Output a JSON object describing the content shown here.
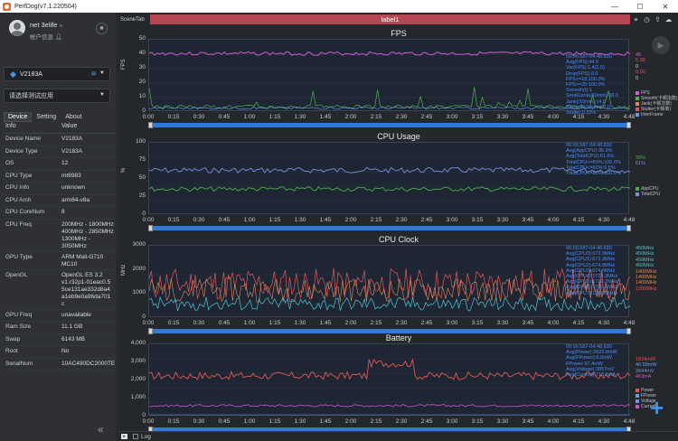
{
  "window": {
    "title": "PerfDog(v7.1.220504)",
    "buttons": [
      "—",
      "☐",
      "✕"
    ]
  },
  "user": {
    "name": "net 3elife",
    "info_label": "帐户信息"
  },
  "device": {
    "selected": "V2183A"
  },
  "app_select": {
    "placeholder": "请选择测试应用"
  },
  "tabs": [
    "Device",
    "Setting",
    "About"
  ],
  "info": {
    "headers": [
      "Info",
      "Value"
    ],
    "rows": [
      {
        "k": "Device Name",
        "v": "V2183A"
      },
      {
        "k": "Device Type",
        "v": "V2183A"
      },
      {
        "k": "OS",
        "v": "12"
      },
      {
        "k": "CPU Type",
        "v": "mt6983"
      },
      {
        "k": "CPU Info",
        "v": "unknown"
      },
      {
        "k": "CPU Arch",
        "v": "arm64-v8a"
      },
      {
        "k": "CPU CoreNum",
        "v": "8"
      },
      {
        "k": "CPU Freq",
        "v": "200MHz - 1800MHz\n400MHz - 2850MHz\n1300MHz -\n3050MHz"
      },
      {
        "k": "GPU Type",
        "v": "ARM Mali-G710\nMC10"
      },
      {
        "k": "OpenGL",
        "v": "OpenGL ES 3.2\nv1.r32p1-01eac0.5\n5ce131ae332d8a4\na1eb9e0a96da701\nc"
      },
      {
        "k": "GPU Freq",
        "v": "unavailable"
      },
      {
        "k": "Ram Size",
        "v": "11.1 GB"
      },
      {
        "k": "Swap",
        "v": "6143 MB"
      },
      {
        "k": "Root",
        "v": "No"
      },
      {
        "k": "SerialNum",
        "v": "10AC490DC2000TE"
      }
    ]
  },
  "scene": {
    "tab": "SceneTab",
    "label": "label1"
  },
  "x_ticks": [
    "0:00",
    "0:15",
    "0:30",
    "0:45",
    "1:00",
    "1:15",
    "1:30",
    "1:45",
    "2:00",
    "2:15",
    "2:30",
    "2:45",
    "3:00",
    "3:15",
    "3:30",
    "3:45",
    "4:00",
    "4:15",
    "4:30",
    "4:48"
  ],
  "panels": [
    {
      "title": "FPS",
      "ylabel": "FPS",
      "yticks": [
        "50",
        "40",
        "30",
        "20",
        "10",
        "0"
      ],
      "legend_box": [
        "00:00.587-04:48.630",
        "Avg(FPS):44.5",
        "Var(FPS):1.4(1.5)",
        "Drop(FPS):0.0",
        "FPS>=18:100.0%",
        "FPS>=25:100.0%",
        "Smooth(t):1",
        "SmallJank(/10min):68.0",
        "Jank(/10min):14.0",
        "BigJank(/10min):0.0",
        "Stutter:0.32%"
      ],
      "right_values": [
        {
          "t": "45",
          "c": "#d25ad3"
        },
        {
          "t": "5.38",
          "c": "#e05858"
        },
        {
          "t": "0",
          "c": "#cfd3d8"
        },
        {
          "t": "0.00",
          "c": "#e05858"
        },
        {
          "t": "0",
          "c": "#cfd3d8"
        }
      ],
      "right_legend": [
        {
          "t": "FPS",
          "c": "#d25ad3"
        },
        {
          "t": "Smooth(卡顿指数)",
          "c": "#4caf50"
        },
        {
          "t": "Jank(卡顿次数)",
          "c": "#e08a5a"
        },
        {
          "t": "Stutter(卡顿率)",
          "c": "#e05858"
        },
        {
          "t": "InterFrame",
          "c": "#5fa0e8"
        }
      ]
    },
    {
      "title": "CPU Usage",
      "ylabel": "%",
      "yticks": [
        "100",
        "75",
        "50",
        "25",
        "0"
      ],
      "legend_box": [
        "00:00.587-04:48.630",
        "Avg(AppCPU):35.9%",
        "Avg(TotalCPU):61.6%",
        "TotalCPU<=50%:100.0%",
        "TotalCPU<=60%:6.5%",
        "TotalCPU<=80%:100.0%"
      ],
      "right_values": [
        {
          "t": "39%",
          "c": "#4caf50"
        },
        {
          "t": "61%",
          "c": "#7a8fe0"
        }
      ],
      "right_legend": [
        {
          "t": "AppCPU",
          "c": "#4caf50"
        },
        {
          "t": "TotalCPU",
          "c": "#7a8fe0"
        }
      ]
    },
    {
      "title": "CPU Clock",
      "ylabel": "MHz",
      "yticks": [
        "3000",
        "2000",
        "1000",
        "0"
      ],
      "legend_box": [
        "00:00.587-04:48.630",
        "Avg(CPU0):672.9MHz",
        "Avg(CPU1):673.3MHz",
        "Avg(CPU2):674.8MHz",
        "Avg(CPU3):674.6MHz",
        "Avg(CPU4):1728.3MHz",
        "Avg(CPU5):1716.2MHz",
        "Avg(CPU6):1710.2MHz",
        "Avg(CPU7):1249.6MHz"
      ],
      "right_values": [
        {
          "t": "450MHz",
          "c": "#4dc6d3"
        },
        {
          "t": "450MHz",
          "c": "#4dc6d3"
        },
        {
          "t": "450MHz",
          "c": "#4dc6d3"
        },
        {
          "t": "450MHz",
          "c": "#4dc6d3"
        },
        {
          "t": "1400MHz",
          "c": "#e08a5a"
        },
        {
          "t": "1400MHz",
          "c": "#e08a5a"
        },
        {
          "t": "1400MHz",
          "c": "#e08a5a"
        },
        {
          "t": "1200MHz",
          "c": "#e05858"
        }
      ],
      "right_legend": []
    },
    {
      "title": "Battery",
      "ylabel": "",
      "yticks": [
        "4,000",
        "3,000",
        "2,000",
        "1,000",
        "0"
      ],
      "legend_box": [
        "00:00.587-04:48.630",
        "Avg(Power):2622.8mW",
        "Avg(FPower):0.0mW",
        "FPower:97.4mW",
        "Avg(Voltage):3857mV",
        "Avg(Current):718.6mA"
      ],
      "right_values": [
        {
          "t": "1824mW",
          "c": "#e05858"
        },
        {
          "t": "40.58mW",
          "c": "#5fa0e8"
        },
        {
          "t": "3844mV",
          "c": "#7a8fe0"
        },
        {
          "t": "463mA",
          "c": "#c85ac8"
        }
      ],
      "right_legend": [
        {
          "t": "Power",
          "c": "#e05858"
        },
        {
          "t": "FPower",
          "c": "#5fa0e8"
        },
        {
          "t": "Voltage",
          "c": "#7a8fe0"
        },
        {
          "t": "Current",
          "c": "#c85ac8"
        }
      ]
    }
  ],
  "bottom": {
    "log_label": "Log"
  }
}
